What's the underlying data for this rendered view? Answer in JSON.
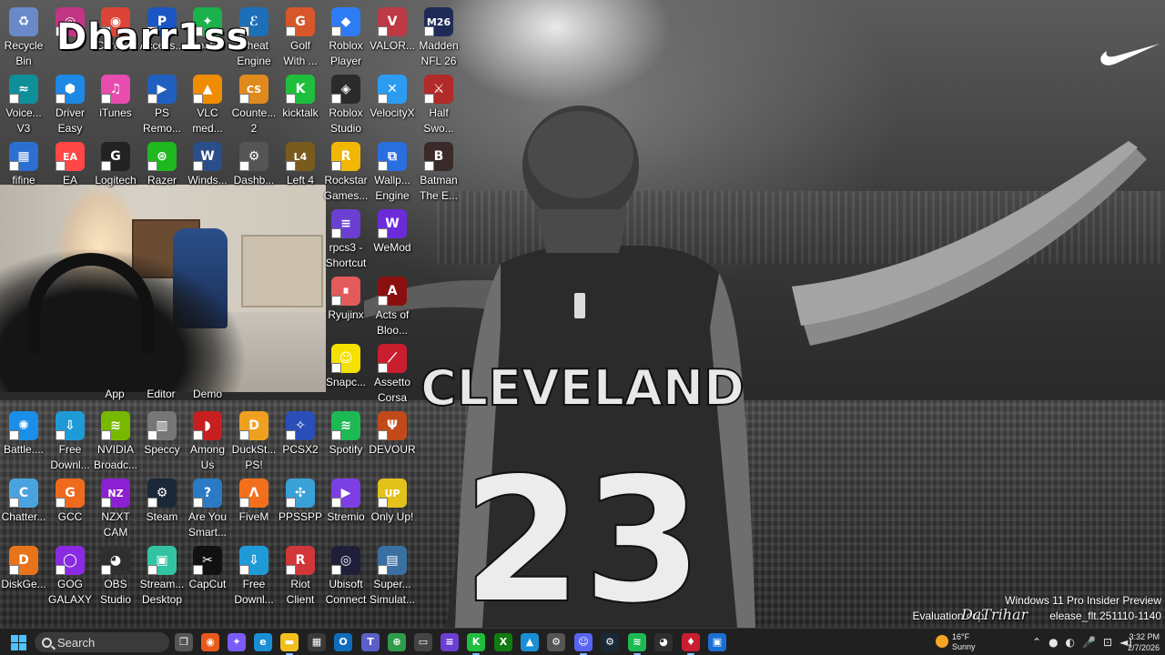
{
  "overlay_name": "Dharr1ss",
  "desktop_icons": [
    {
      "label": "Recycle\nBin",
      "icon": "recycle-bin-icon",
      "color": "#6a89c9",
      "glyph": "♻"
    },
    {
      "label": "D...",
      "icon": "instagram-icon",
      "color": "#c13584",
      "glyph": "◎"
    },
    {
      "label": "Chrome",
      "icon": "chrome-icon",
      "color": "#db4437",
      "glyph": "◉"
    },
    {
      "label": "Access...",
      "icon": "ps-accessory-icon",
      "color": "#1a56c4",
      "glyph": "P"
    },
    {
      "label": "Spati...",
      "icon": "spatial-audio-icon",
      "color": "#1bb14b",
      "glyph": "✦"
    },
    {
      "label": "Cheat\nEngine",
      "icon": "cheat-engine-icon",
      "color": "#1d6fb8",
      "glyph": "ℰ"
    },
    {
      "label": "Golf\nWith ...",
      "icon": "golf-with-friends-icon",
      "color": "#d7572a",
      "glyph": "G"
    },
    {
      "label": "Roblox\nPlayer",
      "icon": "roblox-player-icon",
      "color": "#2d7cf6",
      "glyph": "◆"
    },
    {
      "label": "VALOR...",
      "icon": "valorant-icon",
      "color": "#bd3944",
      "glyph": "V"
    },
    {
      "label": "Madden\nNFL 26",
      "icon": "madden-icon",
      "color": "#1f2b57",
      "glyph": "M26"
    },
    {
      "label": "Voice...\nV3",
      "icon": "voicemod-icon",
      "color": "#0f8f9a",
      "glyph": "≈"
    },
    {
      "label": "Driver\nEasy",
      "icon": "driver-easy-icon",
      "color": "#1e88e5",
      "glyph": "⬢"
    },
    {
      "label": "iTunes",
      "icon": "itunes-icon",
      "color": "#e84caf",
      "glyph": "♫"
    },
    {
      "label": "PS\nRemo...",
      "icon": "ps-remote-play-icon",
      "color": "#1f5fbf",
      "glyph": "▶"
    },
    {
      "label": "VLC\nmed...",
      "icon": "vlc-icon",
      "color": "#f08c00",
      "glyph": "▲"
    },
    {
      "label": "Counte...\n2",
      "icon": "counter-strike-icon",
      "color": "#e08a1e",
      "glyph": "CS"
    },
    {
      "label": "kicktalk",
      "icon": "kicktalk-icon",
      "color": "#1fbf3e",
      "glyph": "K"
    },
    {
      "label": "Roblox\nStudio",
      "icon": "roblox-studio-icon",
      "color": "#2b2b2b",
      "glyph": "◈"
    },
    {
      "label": "VelocityX",
      "icon": "velocityx-icon",
      "color": "#2c9cf0",
      "glyph": "✕"
    },
    {
      "label": "Half\nSwo...",
      "icon": "half-sword-icon",
      "color": "#b22a2a",
      "glyph": "⚔"
    },
    {
      "label": "fifine",
      "icon": "fifine-icon",
      "color": "#2b6fd1",
      "glyph": "▦"
    },
    {
      "label": "EA",
      "icon": "ea-icon",
      "color": "#ff4747",
      "glyph": "EA"
    },
    {
      "label": "Logitech",
      "icon": "logitech-icon",
      "color": "#222222",
      "glyph": "G"
    },
    {
      "label": "Razer",
      "icon": "razer-icon",
      "color": "#1fb81f",
      "glyph": "⊛"
    },
    {
      "label": "Winds...",
      "icon": "windscribe-icon",
      "color": "#2a4e8a",
      "glyph": "W"
    },
    {
      "label": "Dashb...",
      "icon": "dashboard-icon",
      "color": "#555555",
      "glyph": "⚙"
    },
    {
      "label": "Left 4",
      "icon": "left-4-dead-icon",
      "color": "#7a5b1e",
      "glyph": "L4"
    },
    {
      "label": "Rockstar\nGames...",
      "icon": "rockstar-icon",
      "color": "#f2b705",
      "glyph": "R"
    },
    {
      "label": "Wallp...\nEngine",
      "icon": "wallpaper-engine-icon",
      "color": "#2a6fe0",
      "glyph": "⧉"
    },
    {
      "label": "Batman\nThe E...",
      "icon": "batman-icon",
      "color": "#3a2a2a",
      "glyph": "B"
    },
    {
      "label": "rpcs3 -\nShortcut",
      "icon": "rpcs3-icon",
      "color": "#6a3fd1",
      "glyph": "≡"
    },
    {
      "label": "WeMod",
      "icon": "wemod-icon",
      "color": "#6c2bd9",
      "glyph": "W"
    },
    {
      "label": "Ryujinx",
      "icon": "ryujinx-icon",
      "color": "#e25a5a",
      "glyph": "⏸"
    },
    {
      "label": "Acts of\nBloo...",
      "icon": "acts-of-blood-icon",
      "color": "#8a1010",
      "glyph": "A"
    },
    {
      "label": "Snapc...",
      "icon": "snapchat-icon",
      "color": "#f5e100",
      "glyph": "☺"
    },
    {
      "label": "Assetto\nCorsa",
      "icon": "assetto-corsa-icon",
      "color": "#c81e2e",
      "glyph": "⟋"
    },
    {
      "label": "Battle....",
      "icon": "battlenet-icon",
      "color": "#1b8ee8",
      "glyph": "✺"
    },
    {
      "label": "Free\nDownl...",
      "icon": "free-download-manager-icon",
      "color": "#1e9bd7",
      "glyph": "⇩"
    },
    {
      "label": "NVIDIA\nBroadc...",
      "icon": "nvidia-broadcast-icon",
      "color": "#76b900",
      "glyph": "≋"
    },
    {
      "label": "Speccy",
      "icon": "speccy-icon",
      "color": "#777777",
      "glyph": "▥"
    },
    {
      "label": "Among\nUs",
      "icon": "among-us-icon",
      "color": "#c71f1f",
      "glyph": "◗"
    },
    {
      "label": "DuckSt...\nPS!",
      "icon": "duckstation-icon",
      "color": "#f0a020",
      "glyph": "D"
    },
    {
      "label": "PCSX2",
      "icon": "pcsx2-icon",
      "color": "#2a4fb8",
      "glyph": "✧"
    },
    {
      "label": "Spotify",
      "icon": "spotify-icon",
      "color": "#1db954",
      "glyph": "≋"
    },
    {
      "label": "DEVOUR",
      "icon": "devour-icon",
      "color": "#c24a1a",
      "glyph": "Ψ"
    },
    {
      "label": "Chatter...",
      "icon": "chatterino-icon",
      "color": "#4aa3df",
      "glyph": "C"
    },
    {
      "label": "GCC",
      "icon": "gcc-icon",
      "color": "#f06a1e",
      "glyph": "G"
    },
    {
      "label": "NZXT\nCAM",
      "icon": "nzxt-cam-icon",
      "color": "#8b1fd1",
      "glyph": "NZ"
    },
    {
      "label": "Steam",
      "icon": "steam-icon",
      "color": "#1b2838",
      "glyph": "⚙"
    },
    {
      "label": "Are You\nSmart...",
      "icon": "are-you-smart-icon",
      "color": "#2a7ac4",
      "glyph": "?"
    },
    {
      "label": "FiveM",
      "icon": "fivem-icon",
      "color": "#f2701c",
      "glyph": "Λ"
    },
    {
      "label": "PPSSPP",
      "icon": "ppsspp-icon",
      "color": "#3aa0d8",
      "glyph": "✣"
    },
    {
      "label": "Stremio",
      "icon": "stremio-icon",
      "color": "#7b3fe4",
      "glyph": "▶"
    },
    {
      "label": "Only Up!",
      "icon": "only-up-icon",
      "color": "#e3c21b",
      "glyph": "UP"
    },
    {
      "label": "DiskGe...",
      "icon": "diskgenius-icon",
      "color": "#e8731a",
      "glyph": "D"
    },
    {
      "label": "GOG\nGALAXY",
      "icon": "gog-galaxy-icon",
      "color": "#8a2be2",
      "glyph": "◯"
    },
    {
      "label": "OBS\nStudio",
      "icon": "obs-studio-icon",
      "color": "#302e31",
      "glyph": "◕"
    },
    {
      "label": "Stream...\nDesktop",
      "icon": "streamlabs-icon",
      "color": "#31c3a2",
      "glyph": "▣"
    },
    {
      "label": "CapCut",
      "icon": "capcut-icon",
      "color": "#111111",
      "glyph": "✂"
    },
    {
      "label": "Free\nDownl...",
      "icon": "free-download-manager-icon",
      "color": "#1e9bd7",
      "glyph": "⇩"
    },
    {
      "label": "Riot\nClient",
      "icon": "riot-client-icon",
      "color": "#d13639",
      "glyph": "R"
    },
    {
      "label": "Ubisoft\nConnect",
      "icon": "ubisoft-connect-icon",
      "color": "#1f1f3a",
      "glyph": "◎"
    },
    {
      "label": "Super...\nSimulat...",
      "icon": "supermarket-simulator-icon",
      "color": "#3a6fa3",
      "glyph": "▤"
    }
  ],
  "partial_labels": [
    "App",
    "Editor",
    "Demo"
  ],
  "watermark": {
    "line1": "Windows 11 Pro Insider Preview",
    "line2": "Evaluation cop",
    "line2b": "elease_flt.251110-1140",
    "overlay": "DaTrihar"
  },
  "taskbar": {
    "search_placeholder": "Search",
    "apps": [
      {
        "icon": "task-view-icon",
        "color": "#555555",
        "glyph": "❐"
      },
      {
        "icon": "firefox-icon",
        "color": "#e8591a",
        "glyph": "◉"
      },
      {
        "icon": "copilot-icon",
        "color": "#7a5af8",
        "glyph": "✦"
      },
      {
        "icon": "edge-icon",
        "color": "#1a8fd6",
        "glyph": "e"
      },
      {
        "icon": "file-explorer-icon",
        "color": "#f2c01c",
        "glyph": "▬"
      },
      {
        "icon": "store-icon",
        "color": "#3a3a3a",
        "glyph": "▦"
      },
      {
        "icon": "outlook-icon",
        "color": "#0f6cbd",
        "glyph": "O"
      },
      {
        "icon": "teams-icon",
        "color": "#5b5fc7",
        "glyph": "T"
      },
      {
        "icon": "app-green-icon",
        "color": "#2e9c4a",
        "glyph": "⊕"
      },
      {
        "icon": "app-window-icon",
        "color": "#444444",
        "glyph": "▭"
      },
      {
        "icon": "app-purple-icon",
        "color": "#6a3fd1",
        "glyph": "≡"
      },
      {
        "icon": "kicktalk-taskbar-icon",
        "color": "#1fbf3e",
        "glyph": "K"
      },
      {
        "icon": "xbox-icon",
        "color": "#107c10",
        "glyph": "X"
      },
      {
        "icon": "photos-icon",
        "color": "#1a8fd6",
        "glyph": "▲"
      },
      {
        "icon": "settings-icon",
        "color": "#555555",
        "glyph": "⚙"
      },
      {
        "icon": "discord-icon",
        "color": "#5865f2",
        "glyph": "☺"
      },
      {
        "icon": "steam-taskbar-icon",
        "color": "#1b2838",
        "glyph": "⚙"
      },
      {
        "icon": "spotify-taskbar-icon",
        "color": "#1db954",
        "glyph": "≋"
      },
      {
        "icon": "obs-taskbar-icon",
        "color": "#302e31",
        "glyph": "◕"
      },
      {
        "icon": "app-red-icon",
        "color": "#c81e2e",
        "glyph": "♦"
      },
      {
        "icon": "app-blue-icon",
        "color": "#1a6fd6",
        "glyph": "▣"
      }
    ],
    "weather": {
      "temp": "16°F",
      "condition": "Sunny"
    },
    "clock": {
      "time": "3:32 PM",
      "date": "2/7/2026"
    }
  },
  "wallpaper": {
    "jersey_team": "CLEVELAND",
    "jersey_number": "23"
  }
}
